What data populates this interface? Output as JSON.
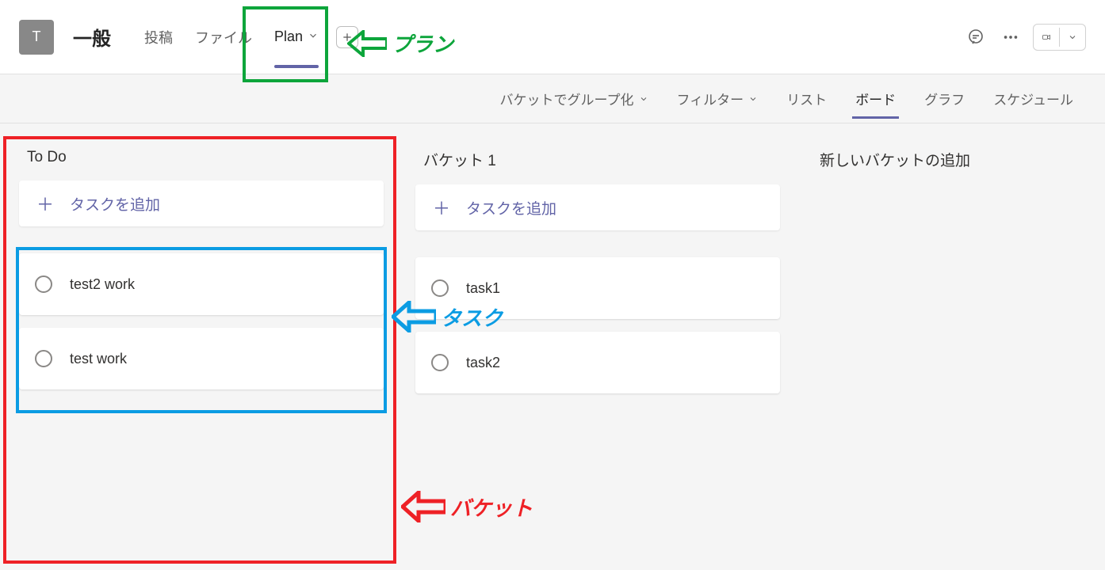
{
  "header": {
    "team_letter": "T",
    "channel": "一般",
    "tabs": {
      "posts": "投稿",
      "files": "ファイル",
      "plan": "Plan"
    }
  },
  "planbar": {
    "group_by": "バケットでグループ化",
    "filter": "フィルター",
    "views": {
      "list": "リスト",
      "board": "ボード",
      "chart": "グラフ",
      "schedule": "スケジュール"
    }
  },
  "board": {
    "add_task_label": "タスクを追加",
    "new_bucket": "新しいバケットの追加",
    "buckets": [
      {
        "title": "To Do",
        "tasks": [
          "test2 work",
          "test work"
        ]
      },
      {
        "title": "バケット 1",
        "tasks": [
          "task1",
          "task2"
        ]
      }
    ]
  },
  "annotations": {
    "plan": "プラン",
    "task": "タスク",
    "bucket": "バケット"
  }
}
